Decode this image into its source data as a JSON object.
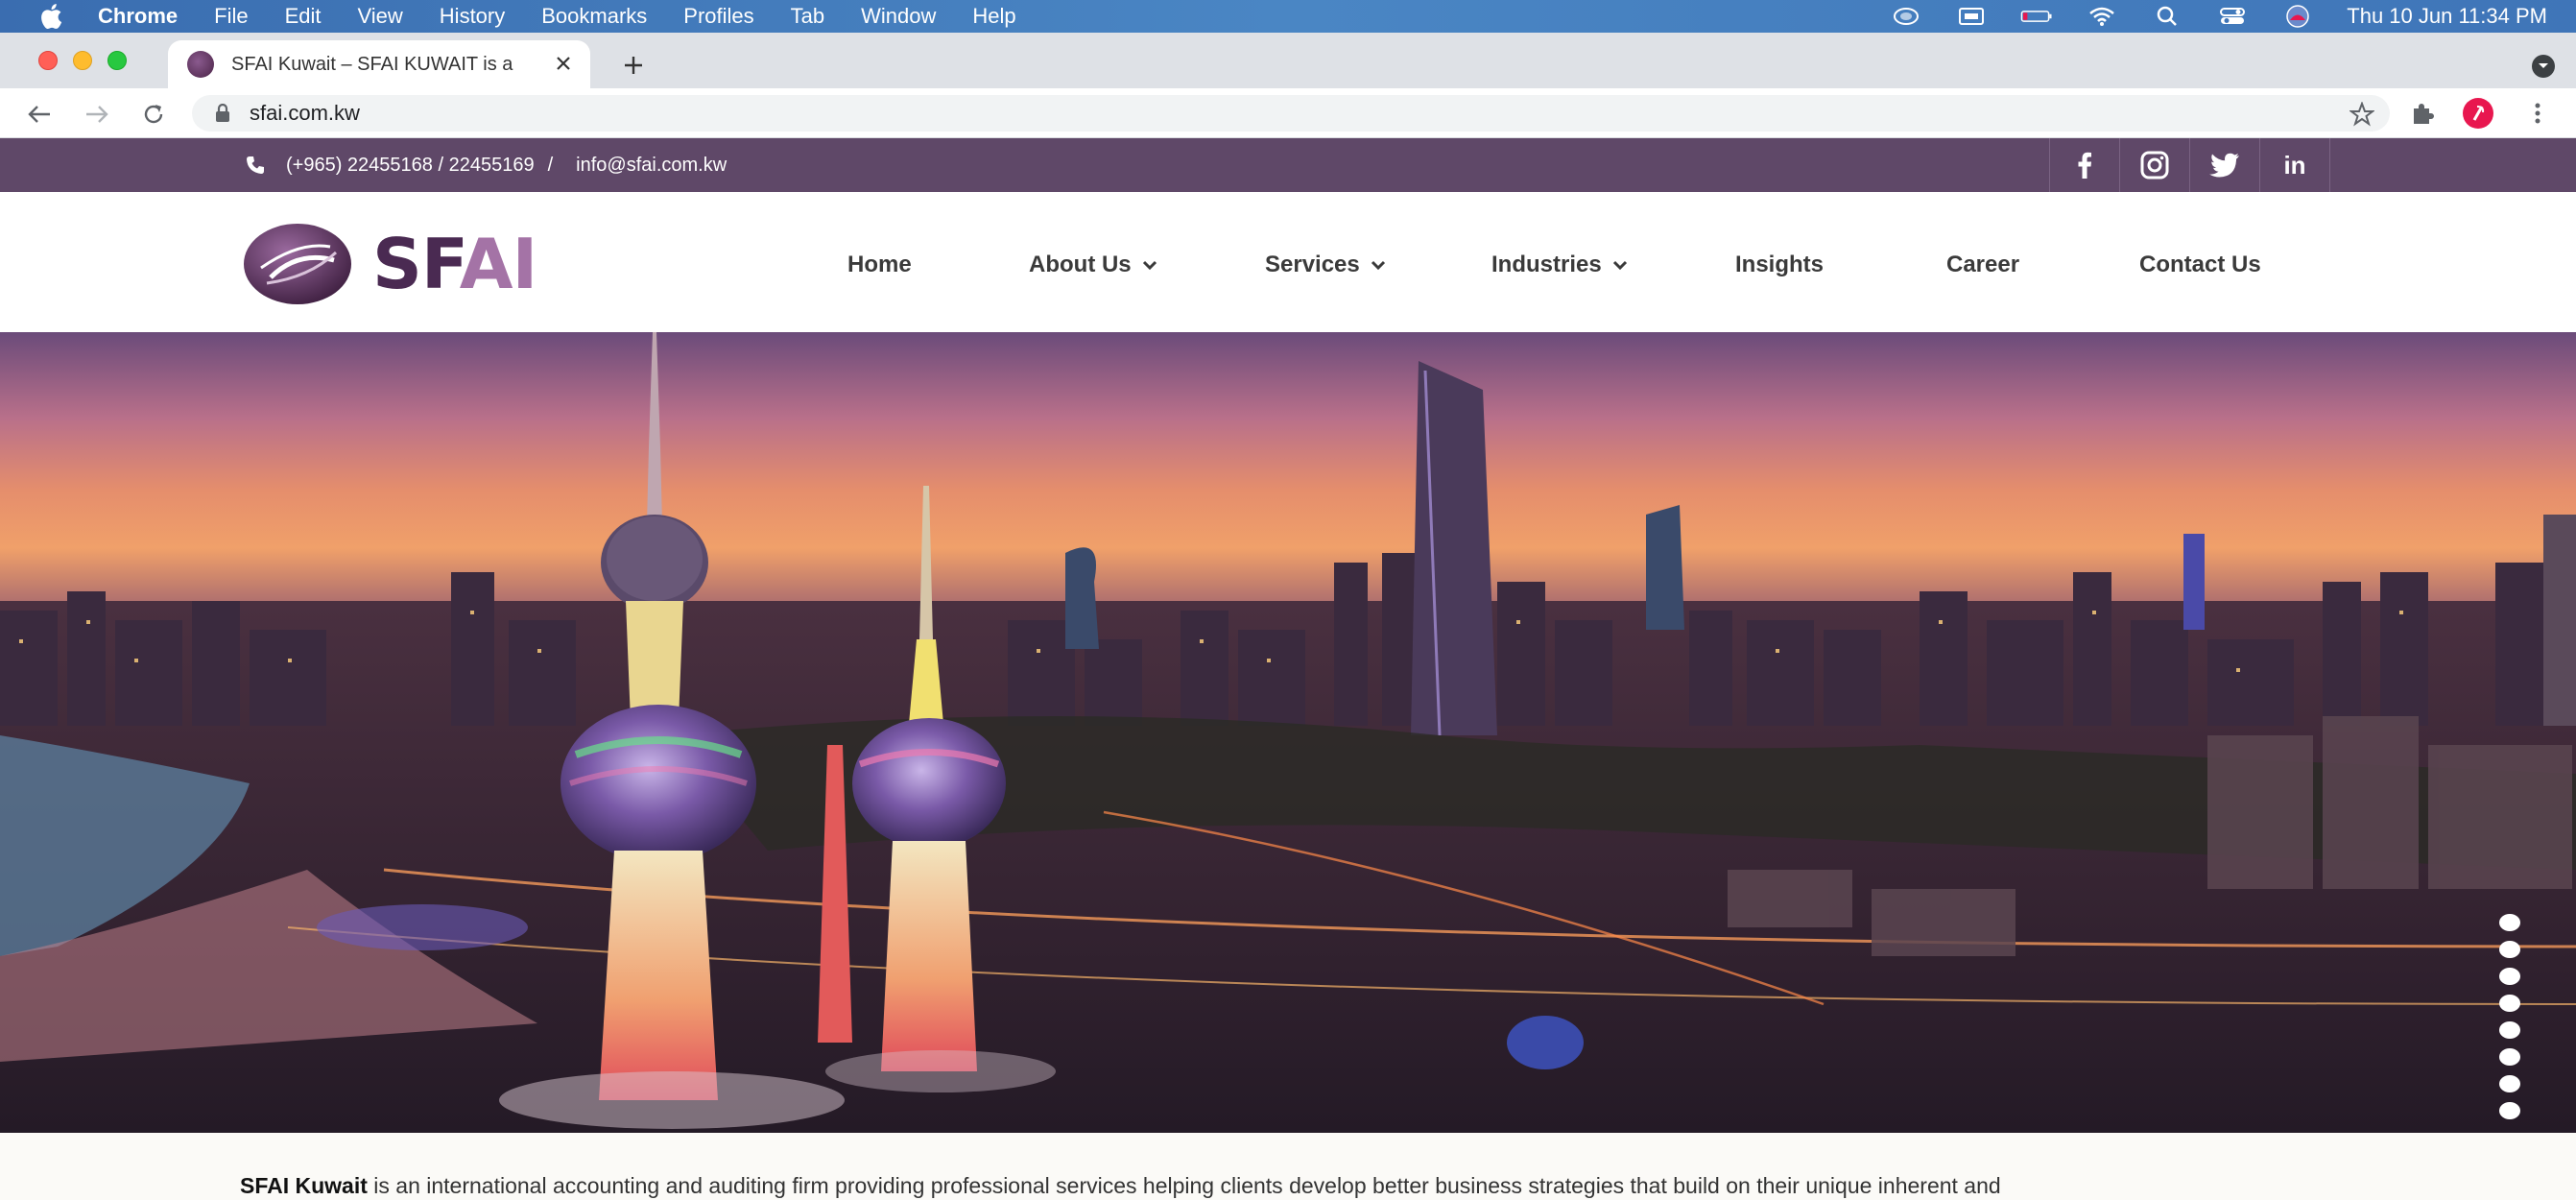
{
  "menubar": {
    "app": "Chrome",
    "items": [
      "File",
      "Edit",
      "View",
      "History",
      "Bookmarks",
      "Profiles",
      "Tab",
      "Window",
      "Help"
    ],
    "clock": "Thu 10 Jun  11:34 PM"
  },
  "browser": {
    "tab_title": "SFAI Kuwait – SFAI KUWAIT is a",
    "url": "sfai.com.kw"
  },
  "site": {
    "phone": "(+965) 22455168 / 22455169",
    "separator": "/",
    "email": "info@sfai.com.kw",
    "social": [
      "facebook-icon",
      "instagram-icon",
      "twitter-icon",
      "linkedin-icon"
    ],
    "linkedin_label": "in",
    "logo": {
      "sf": "SF",
      "ai": "AI"
    },
    "nav": [
      {
        "label": "Home",
        "dropdown": false
      },
      {
        "label": "About Us",
        "dropdown": true
      },
      {
        "label": "Services",
        "dropdown": true
      },
      {
        "label": "Industries",
        "dropdown": true
      },
      {
        "label": "Insights",
        "dropdown": false
      },
      {
        "label": "Career",
        "dropdown": false
      },
      {
        "label": "Contact Us",
        "dropdown": false
      }
    ],
    "slider_dot_count": 8,
    "intro_bold": "SFAI Kuwait",
    "intro_text": " is an international accounting and auditing firm providing professional services helping clients develop better business strategies that build on their unique inherent and"
  },
  "colors": {
    "topbar": "#5f4868",
    "logo_dark": "#4a2a52",
    "logo_light": "#a473a6",
    "nav_text": "#3a3a3a"
  }
}
